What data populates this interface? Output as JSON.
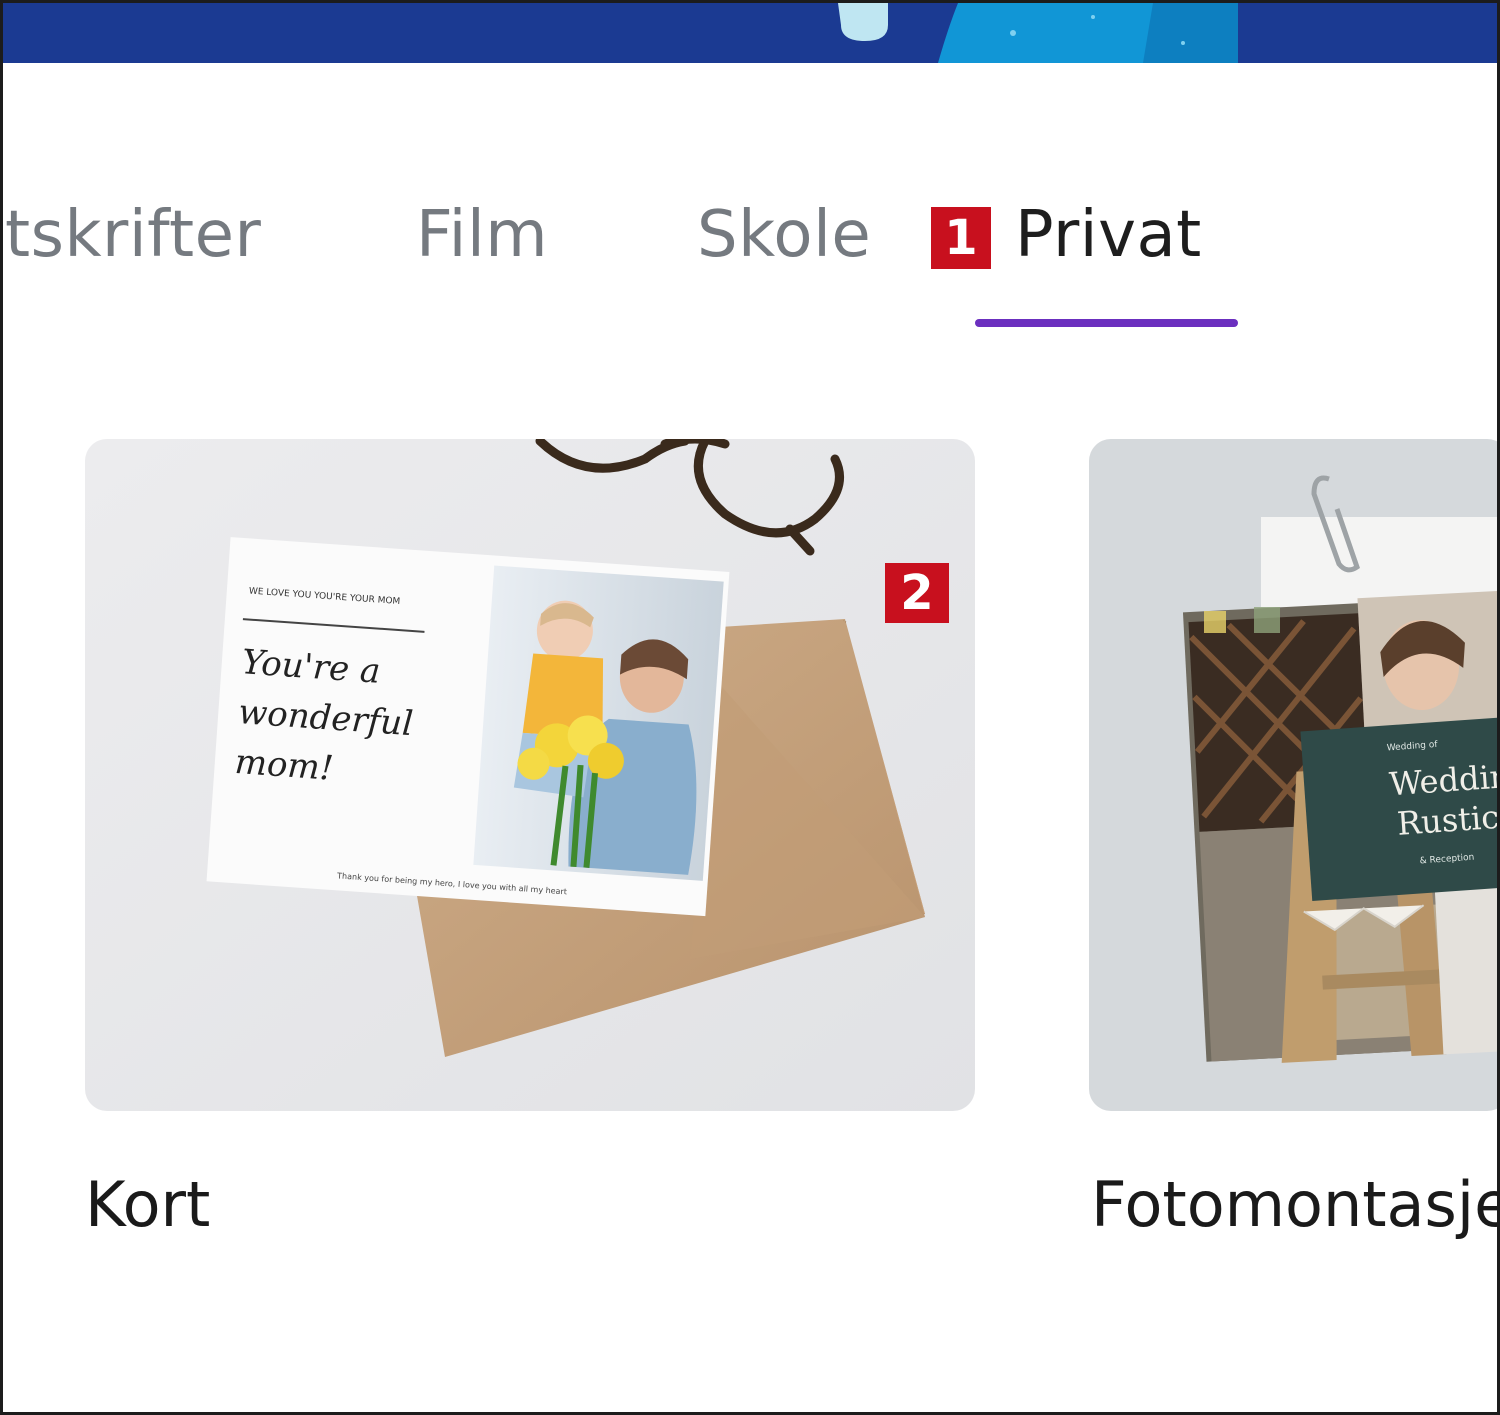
{
  "tabs": [
    {
      "label": "tskrifter",
      "active": false
    },
    {
      "label": "Film",
      "active": false
    },
    {
      "label": "Skole",
      "active": false
    },
    {
      "label": "Privat",
      "active": true
    }
  ],
  "callouts": [
    "1",
    "2"
  ],
  "cards": [
    {
      "label": "Kort",
      "preview": {
        "card_text_small": "WE LOVE YOU\nYOU'RE YOUR MOM",
        "card_script": [
          "You're a",
          "wonderful",
          "mom!"
        ],
        "footer_text": "Thank you for being my hero, I love you with all my heart"
      }
    },
    {
      "label": "Fotomontasje",
      "preview": {
        "sign_small_top": "Wedding of",
        "sign_title": [
          "Weddin",
          "Rustic R"
        ],
        "sign_small_bottom": "& Reception"
      }
    }
  ],
  "colors": {
    "banner": "#1b3a92",
    "tab_underline": "#6b2fbf",
    "callout": "#c8101e",
    "tab_inactive": "#757a80",
    "tab_active": "#1e1e1e"
  }
}
